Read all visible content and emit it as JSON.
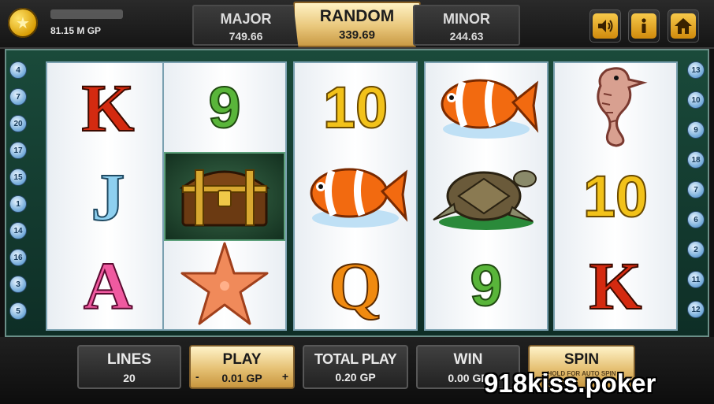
{
  "header": {
    "balance": "81.15 M GP",
    "jackpots": {
      "major": {
        "label": "MAJOR",
        "value": "749.66"
      },
      "random": {
        "label": "RANDOM",
        "value": "339.69"
      },
      "minor": {
        "label": "MINOR",
        "value": "244.63"
      }
    },
    "icons": {
      "sound": "speaker-icon",
      "info": "info-icon",
      "home": "home-icon"
    }
  },
  "reels": [
    [
      "K",
      "J",
      "A"
    ],
    [
      "9",
      "treasure-chest",
      "starfish"
    ],
    [
      "10",
      "clownfish",
      "Q"
    ],
    [
      "clownfish",
      "sea-turtle",
      "9"
    ],
    [
      "seahorse",
      "10",
      "K"
    ]
  ],
  "paylines": {
    "left": [
      "4",
      "7",
      "20",
      "17",
      "15",
      "1",
      "14",
      "16",
      "3",
      "5"
    ],
    "right": [
      "13",
      "10",
      "9",
      "18",
      "7",
      "6",
      "2",
      "11",
      "12"
    ]
  },
  "controls": {
    "lines": {
      "label": "LINES",
      "value": "20"
    },
    "play": {
      "label": "PLAY",
      "value": "0.01 GP",
      "minus": "-",
      "plus": "+"
    },
    "total_play": {
      "label": "TOTAL PLAY",
      "value": "0.20 GP"
    },
    "win": {
      "label": "WIN",
      "value": "0.00 GP"
    },
    "spin": {
      "label": "SPIN",
      "sub": "HOLD FOR AUTO SPIN"
    }
  },
  "watermark": "918kiss.poker",
  "colors": {
    "accent_gold": "#e5c073",
    "frame_green": "#1a4a3a"
  }
}
